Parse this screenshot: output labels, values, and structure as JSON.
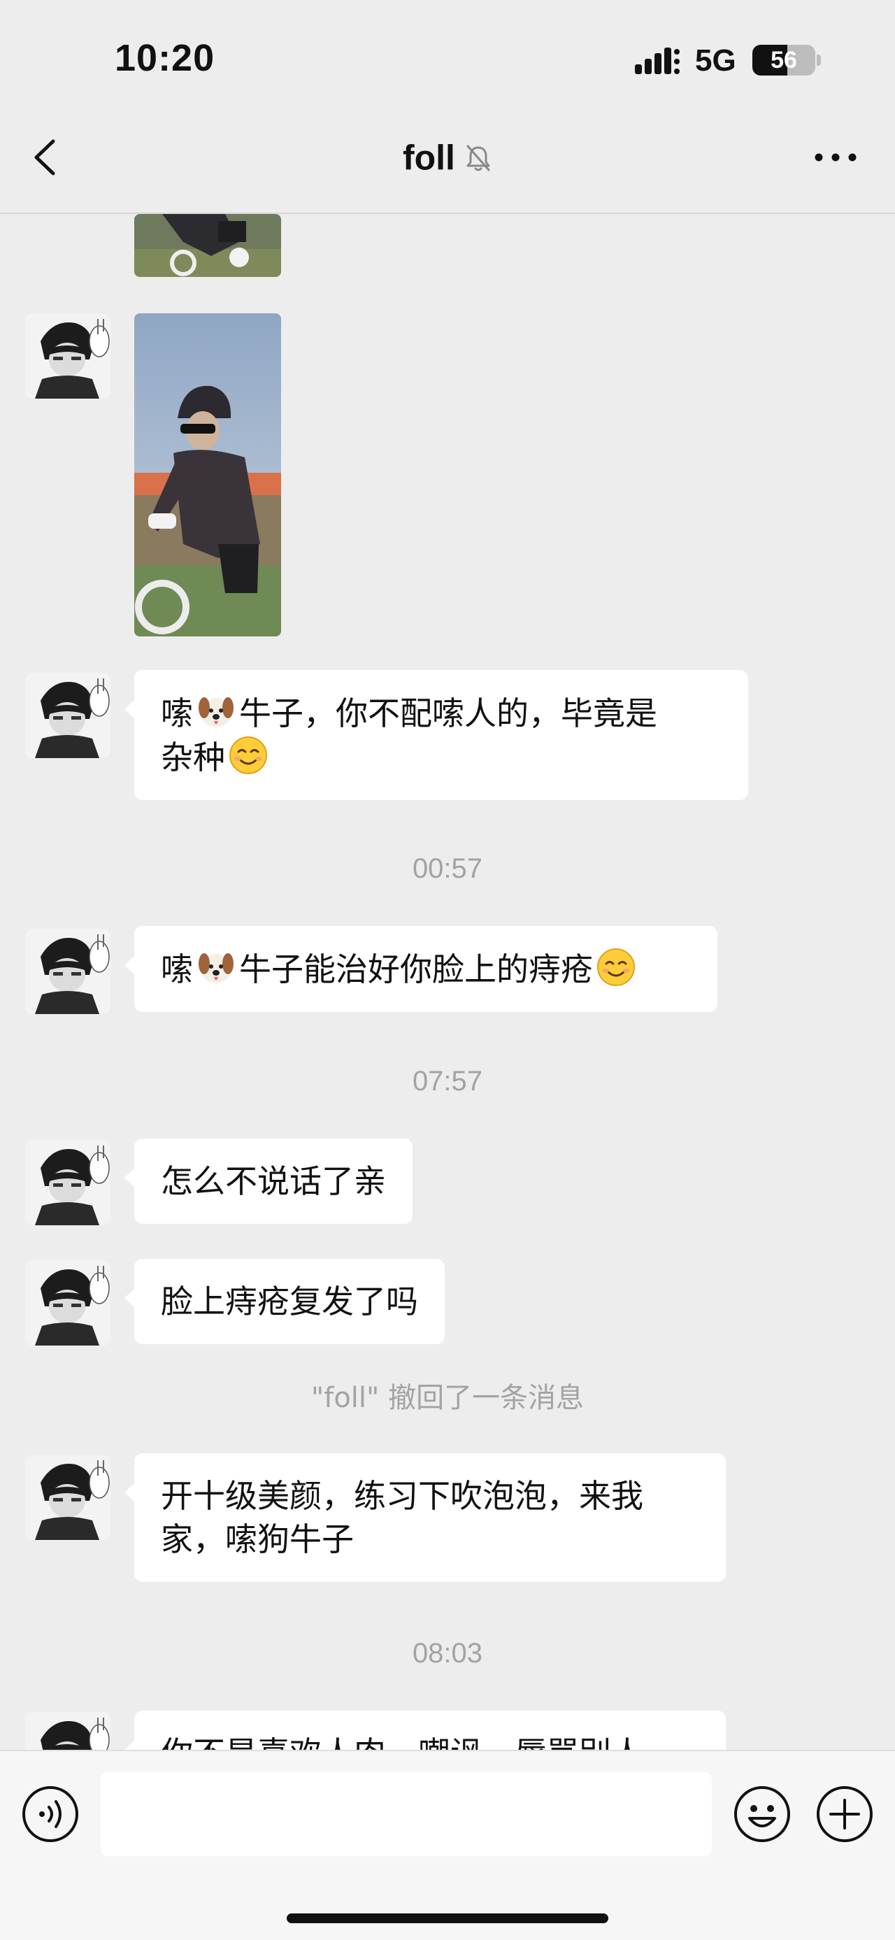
{
  "status_bar": {
    "time": "10:20",
    "network": "5G",
    "battery_level": 56,
    "battery_text": "56",
    "icons": [
      "signal-bars-icon",
      "battery-icon"
    ]
  },
  "header": {
    "title": "foll",
    "icons": [
      "back-chevron-icon",
      "muted-bell-icon",
      "more-dots-icon"
    ]
  },
  "messages": [
    {
      "type": "image",
      "description_icon": "photo-thumbnail",
      "partial": true
    },
    {
      "type": "image",
      "description_icon": "photo-thumbnail"
    },
    {
      "type": "text",
      "parts": [
        "嗦",
        "dog-emoji",
        "牛子，你不配嗦人的，毕竟是",
        "杂种",
        "smile-emoji"
      ]
    },
    {
      "type": "time",
      "text": "00:57"
    },
    {
      "type": "text",
      "parts": [
        "嗦",
        "dog-emoji",
        "牛子能治好你脸上的痔疮",
        "smile-emoji"
      ]
    },
    {
      "type": "time",
      "text": "07:57"
    },
    {
      "type": "text",
      "text": "怎么不说话了亲"
    },
    {
      "type": "text",
      "text": "脸上痔疮复发了吗"
    },
    {
      "type": "system",
      "text": "\"foll\" 撤回了一条消息"
    },
    {
      "type": "text",
      "line1": "开十级美颜，练习下吹泡泡，来我",
      "line2": "家，嗦狗牛子"
    },
    {
      "type": "time",
      "text": "08:03"
    },
    {
      "type": "text",
      "text": "你不是喜欢人肉，嘲讽，辱骂别人",
      "partial": true
    }
  ],
  "input_bar": {
    "value": "",
    "icons": [
      "voice-icon",
      "emoji-icon",
      "plus-icon"
    ]
  }
}
